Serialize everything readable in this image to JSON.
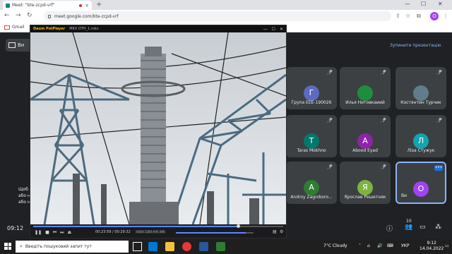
{
  "browser": {
    "tab_title": "Meet: \"bte-zcpd-vrf\"",
    "tab_close": "×",
    "new_tab": "+",
    "url": "meet.google.com/bte-zcpd-vrf",
    "profile_initial": "O",
    "bookmark_gmail": "Gmail",
    "win_min": "—",
    "win_max": "☐",
    "win_close": "✕"
  },
  "meet": {
    "present_label": "Ви",
    "stop_presenting": "Зупинити презентацію",
    "caption_lines": [
      "Щоб",
      "або н",
      "або н"
    ],
    "clock": "09:12",
    "participant_count": "10",
    "participants": [
      {
        "name": "Група ЕЕЕ-190026",
        "initial": "Г",
        "color": "#5c6bc0"
      },
      {
        "name": "Илья Нитовкаиий",
        "initial": "",
        "color": "#1e8e3e"
      },
      {
        "name": "Костянтин Турчик",
        "initial": "",
        "color": "#607d8b"
      },
      {
        "name": "Taras Mokhno",
        "initial": "T",
        "color": "#00796b"
      },
      {
        "name": "Abood Eyad",
        "initial": "A",
        "color": "#8e24aa"
      },
      {
        "name": "Лiза Стужук",
        "initial": "Л",
        "color": "#12a4af"
      },
      {
        "name": "Androy Zagniboro...",
        "initial": "A",
        "color": "#2e7d32"
      },
      {
        "name": "Ярослав Решетняк",
        "initial": "Я",
        "color": "#7cb342"
      },
      {
        "name": "Ви",
        "initial": "О",
        "color": "#a142f4"
      }
    ]
  },
  "player": {
    "logo": "Daum PotPlayer",
    "file": "MKV  OTH_1.mkv",
    "time": "00:23:59 / 00:29:32",
    "info": "H264 1280  AAC 48k",
    "progress": 0.82,
    "volume": 0.9
  },
  "taskbar": {
    "search_placeholder": "Введіть пошуковий запит тут",
    "weather": "7°C  Cloudy",
    "lang": "УКР",
    "time": "9:12",
    "date": "14.04.2022"
  }
}
